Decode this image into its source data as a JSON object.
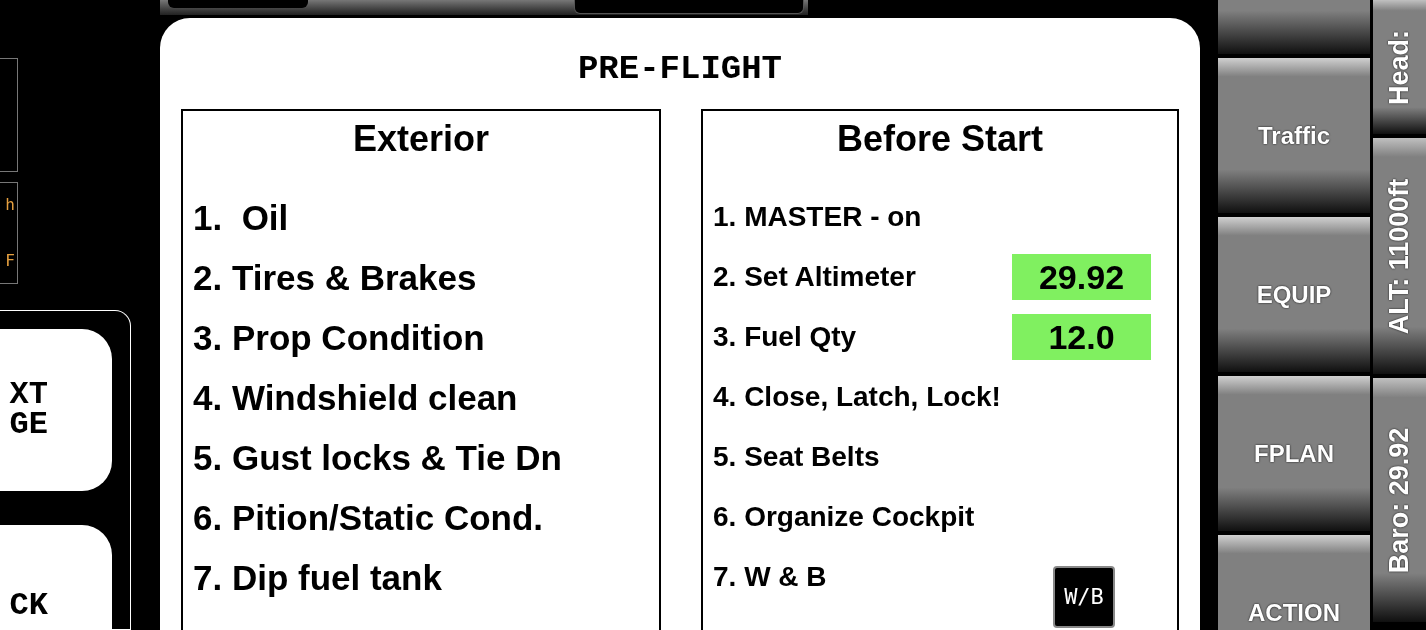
{
  "left_panel": {
    "readouts": [
      "h",
      "F"
    ],
    "buttons": [
      {
        "label": "XT\nGE"
      },
      {
        "label": "CK"
      }
    ]
  },
  "checklist": {
    "title": "PRE-FLIGHT",
    "sections": [
      {
        "heading": "Exterior",
        "items": [
          {
            "kind": "plain",
            "text": "1.  Oil"
          },
          {
            "kind": "plain",
            "text": "2. Tires & Brakes"
          },
          {
            "kind": "plain",
            "text": "3. Prop Condition"
          },
          {
            "kind": "plain",
            "text": "4. Windshield clean"
          },
          {
            "kind": "plain",
            "text": "5. Gust locks & Tie Dn"
          },
          {
            "kind": "plain",
            "text": "6. Pition/Static Cond."
          },
          {
            "kind": "plain",
            "text": "7. Dip fuel tank"
          }
        ]
      },
      {
        "heading": "Before Start",
        "items": [
          {
            "kind": "plain",
            "text": "1. MASTER - on"
          },
          {
            "kind": "value",
            "text": "2. Set Altimeter",
            "value": "29.92"
          },
          {
            "kind": "value",
            "text": "3. Fuel Qty",
            "value": "12.0"
          },
          {
            "kind": "plain",
            "text": "4. Close, Latch, Lock!"
          },
          {
            "kind": "plain",
            "text": "5. Seat Belts"
          },
          {
            "kind": "plain",
            "text": "6. Organize Cockpit"
          },
          {
            "kind": "button",
            "text": "7. W & B",
            "button": "W/B"
          }
        ]
      }
    ]
  },
  "menu_buttons": [
    "Traffic",
    "EQUIP",
    "FPLAN",
    "ACTION"
  ],
  "status_strip": [
    "Head:",
    "ALT: 11000ft",
    "Baro: 29.92"
  ]
}
